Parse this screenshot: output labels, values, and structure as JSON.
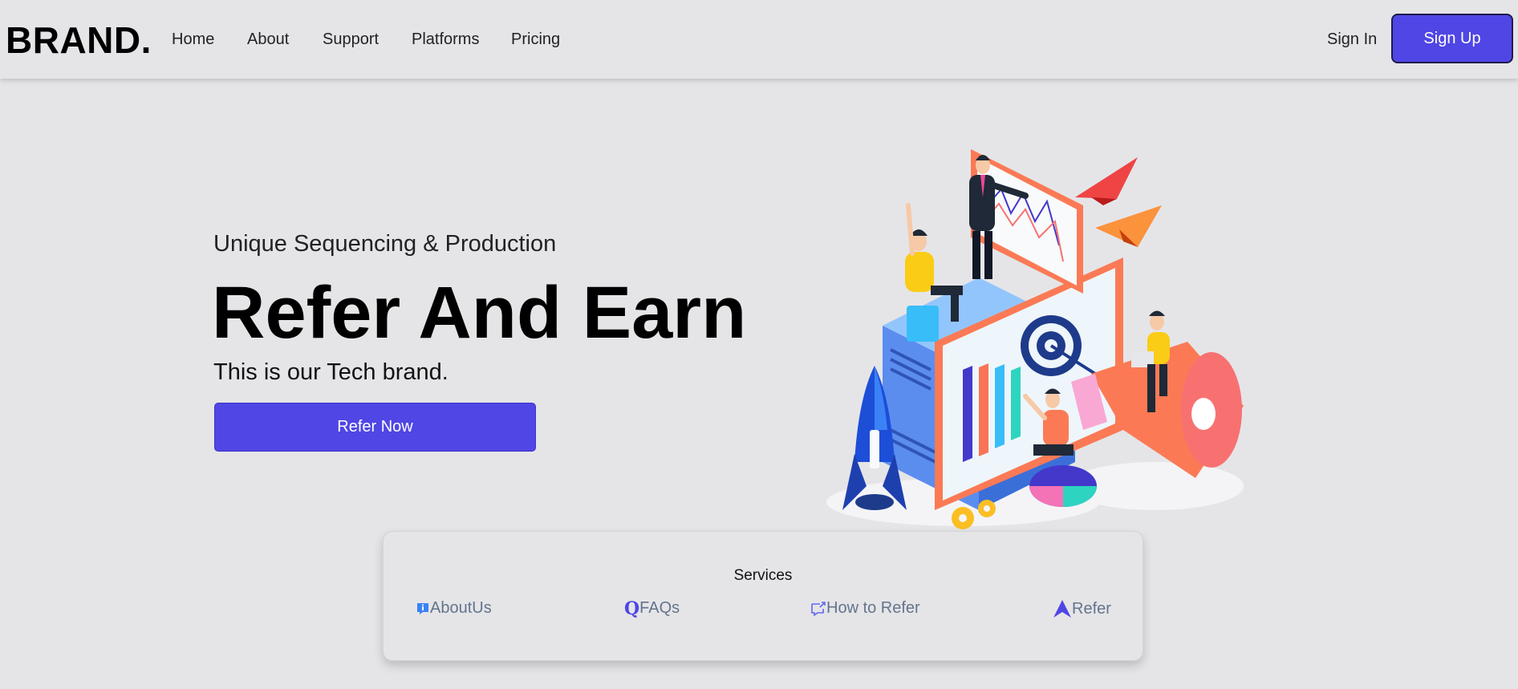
{
  "navbar": {
    "brand": "BRAND.",
    "links": [
      "Home",
      "About",
      "Support",
      "Platforms",
      "Pricing"
    ],
    "sign_in": "Sign In",
    "sign_up": "Sign Up"
  },
  "hero": {
    "subtitle": "Unique Sequencing & Production",
    "title": "Refer And Earn",
    "description": "This is our Tech brand.",
    "cta": "Refer Now",
    "illustration_icon": "marketing-isometric-illustration"
  },
  "services": {
    "title": "Services",
    "links": [
      {
        "label": "AboutUs",
        "icon": "info-icon"
      },
      {
        "label": "FAQs",
        "icon": "q-icon"
      },
      {
        "label": "How to Refer",
        "icon": "share-icon"
      },
      {
        "label": "Refer",
        "icon": "arrow-up-icon"
      }
    ]
  },
  "colors": {
    "accent": "#4f46e5",
    "background": "#e5e5e8",
    "muted_text": "#64748b"
  }
}
